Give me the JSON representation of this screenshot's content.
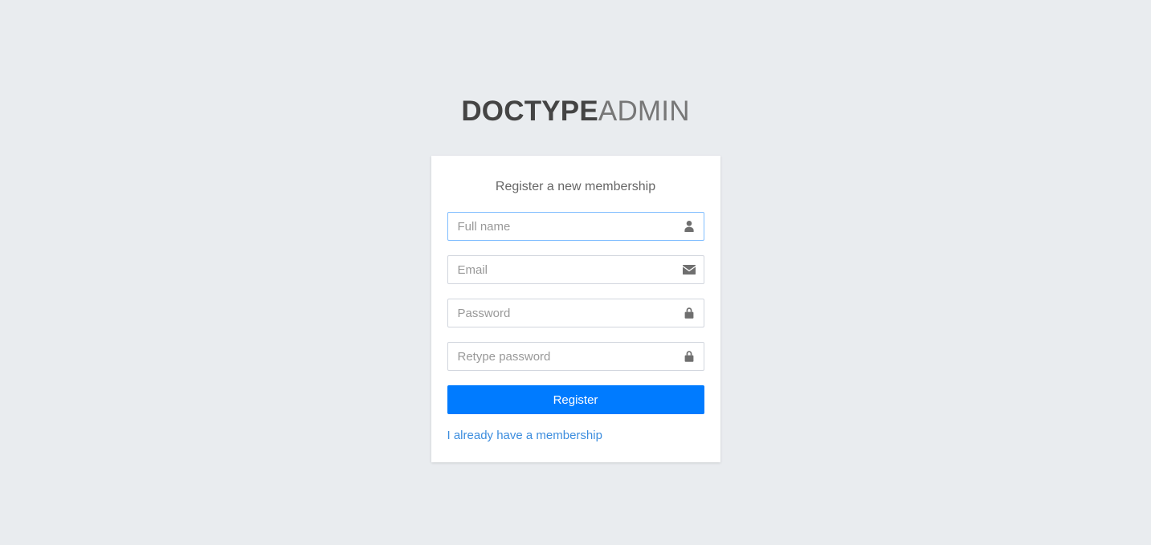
{
  "page": {
    "background_color": "#e9ecef"
  },
  "logo": {
    "strong_text": "DOCTYPE",
    "light_text": "ADMIN"
  },
  "card": {
    "message": "Register a new membership",
    "fields": [
      {
        "name": "full-name",
        "placeholder": "Full name",
        "value": "",
        "icon": "user-icon",
        "focused": true
      },
      {
        "name": "email",
        "placeholder": "Email",
        "value": "",
        "icon": "envelope-icon",
        "focused": false
      },
      {
        "name": "password",
        "placeholder": "Password",
        "value": "",
        "icon": "lock-icon",
        "focused": false
      },
      {
        "name": "retype-password",
        "placeholder": "Retype password",
        "value": "",
        "icon": "lock-icon",
        "focused": false
      }
    ],
    "submit_label": "Register",
    "submit_color": "#007bff",
    "login_link_label": "I already have a membership",
    "login_link_color": "#3c8dde"
  }
}
